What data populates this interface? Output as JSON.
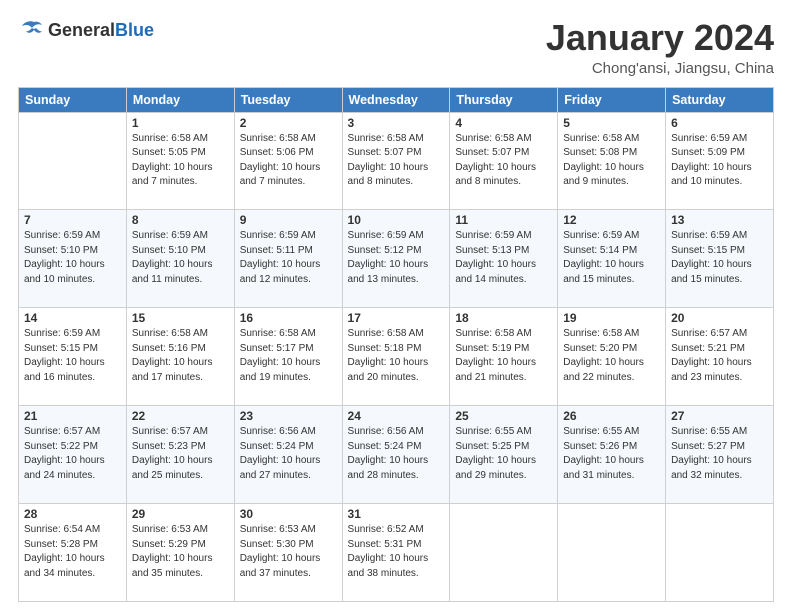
{
  "header": {
    "logo_general": "General",
    "logo_blue": "Blue",
    "month_title": "January 2024",
    "subtitle": "Chong'ansi, Jiangsu, China"
  },
  "columns": [
    "Sunday",
    "Monday",
    "Tuesday",
    "Wednesday",
    "Thursday",
    "Friday",
    "Saturday"
  ],
  "weeks": [
    [
      {
        "day": "",
        "info": ""
      },
      {
        "day": "1",
        "info": "Sunrise: 6:58 AM\nSunset: 5:05 PM\nDaylight: 10 hours\nand 7 minutes."
      },
      {
        "day": "2",
        "info": "Sunrise: 6:58 AM\nSunset: 5:06 PM\nDaylight: 10 hours\nand 7 minutes."
      },
      {
        "day": "3",
        "info": "Sunrise: 6:58 AM\nSunset: 5:07 PM\nDaylight: 10 hours\nand 8 minutes."
      },
      {
        "day": "4",
        "info": "Sunrise: 6:58 AM\nSunset: 5:07 PM\nDaylight: 10 hours\nand 8 minutes."
      },
      {
        "day": "5",
        "info": "Sunrise: 6:58 AM\nSunset: 5:08 PM\nDaylight: 10 hours\nand 9 minutes."
      },
      {
        "day": "6",
        "info": "Sunrise: 6:59 AM\nSunset: 5:09 PM\nDaylight: 10 hours\nand 10 minutes."
      }
    ],
    [
      {
        "day": "7",
        "info": "Sunrise: 6:59 AM\nSunset: 5:10 PM\nDaylight: 10 hours\nand 10 minutes."
      },
      {
        "day": "8",
        "info": "Sunrise: 6:59 AM\nSunset: 5:10 PM\nDaylight: 10 hours\nand 11 minutes."
      },
      {
        "day": "9",
        "info": "Sunrise: 6:59 AM\nSunset: 5:11 PM\nDaylight: 10 hours\nand 12 minutes."
      },
      {
        "day": "10",
        "info": "Sunrise: 6:59 AM\nSunset: 5:12 PM\nDaylight: 10 hours\nand 13 minutes."
      },
      {
        "day": "11",
        "info": "Sunrise: 6:59 AM\nSunset: 5:13 PM\nDaylight: 10 hours\nand 14 minutes."
      },
      {
        "day": "12",
        "info": "Sunrise: 6:59 AM\nSunset: 5:14 PM\nDaylight: 10 hours\nand 15 minutes."
      },
      {
        "day": "13",
        "info": "Sunrise: 6:59 AM\nSunset: 5:15 PM\nDaylight: 10 hours\nand 15 minutes."
      }
    ],
    [
      {
        "day": "14",
        "info": "Sunrise: 6:59 AM\nSunset: 5:15 PM\nDaylight: 10 hours\nand 16 minutes."
      },
      {
        "day": "15",
        "info": "Sunrise: 6:58 AM\nSunset: 5:16 PM\nDaylight: 10 hours\nand 17 minutes."
      },
      {
        "day": "16",
        "info": "Sunrise: 6:58 AM\nSunset: 5:17 PM\nDaylight: 10 hours\nand 19 minutes."
      },
      {
        "day": "17",
        "info": "Sunrise: 6:58 AM\nSunset: 5:18 PM\nDaylight: 10 hours\nand 20 minutes."
      },
      {
        "day": "18",
        "info": "Sunrise: 6:58 AM\nSunset: 5:19 PM\nDaylight: 10 hours\nand 21 minutes."
      },
      {
        "day": "19",
        "info": "Sunrise: 6:58 AM\nSunset: 5:20 PM\nDaylight: 10 hours\nand 22 minutes."
      },
      {
        "day": "20",
        "info": "Sunrise: 6:57 AM\nSunset: 5:21 PM\nDaylight: 10 hours\nand 23 minutes."
      }
    ],
    [
      {
        "day": "21",
        "info": "Sunrise: 6:57 AM\nSunset: 5:22 PM\nDaylight: 10 hours\nand 24 minutes."
      },
      {
        "day": "22",
        "info": "Sunrise: 6:57 AM\nSunset: 5:23 PM\nDaylight: 10 hours\nand 25 minutes."
      },
      {
        "day": "23",
        "info": "Sunrise: 6:56 AM\nSunset: 5:24 PM\nDaylight: 10 hours\nand 27 minutes."
      },
      {
        "day": "24",
        "info": "Sunrise: 6:56 AM\nSunset: 5:24 PM\nDaylight: 10 hours\nand 28 minutes."
      },
      {
        "day": "25",
        "info": "Sunrise: 6:55 AM\nSunset: 5:25 PM\nDaylight: 10 hours\nand 29 minutes."
      },
      {
        "day": "26",
        "info": "Sunrise: 6:55 AM\nSunset: 5:26 PM\nDaylight: 10 hours\nand 31 minutes."
      },
      {
        "day": "27",
        "info": "Sunrise: 6:55 AM\nSunset: 5:27 PM\nDaylight: 10 hours\nand 32 minutes."
      }
    ],
    [
      {
        "day": "28",
        "info": "Sunrise: 6:54 AM\nSunset: 5:28 PM\nDaylight: 10 hours\nand 34 minutes."
      },
      {
        "day": "29",
        "info": "Sunrise: 6:53 AM\nSunset: 5:29 PM\nDaylight: 10 hours\nand 35 minutes."
      },
      {
        "day": "30",
        "info": "Sunrise: 6:53 AM\nSunset: 5:30 PM\nDaylight: 10 hours\nand 37 minutes."
      },
      {
        "day": "31",
        "info": "Sunrise: 6:52 AM\nSunset: 5:31 PM\nDaylight: 10 hours\nand 38 minutes."
      },
      {
        "day": "",
        "info": ""
      },
      {
        "day": "",
        "info": ""
      },
      {
        "day": "",
        "info": ""
      }
    ]
  ]
}
